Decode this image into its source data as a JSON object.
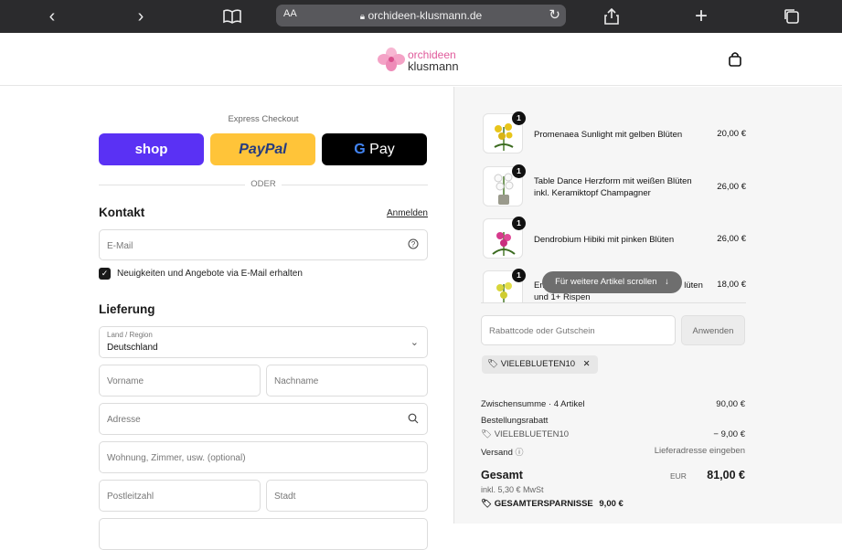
{
  "browser": {
    "text_size_label": "AA",
    "url": "orchideen-klusmann.de"
  },
  "brand": {
    "line1": "orchideen",
    "line2": "klusmann"
  },
  "checkout": {
    "express_label": "Express Checkout",
    "shop_label": "shop",
    "paypal_label": "PayPal",
    "gpay_label": "Pay",
    "gpay_g": "G",
    "divider_label": "ODER",
    "contact_title": "Kontakt",
    "login_label": "Anmelden",
    "email_placeholder": "E-Mail",
    "newsletter_label": "Neuigkeiten und Angebote via E-Mail erhalten",
    "delivery_title": "Lieferung",
    "country_label": "Land / Region",
    "country_value": "Deutschland",
    "firstname_placeholder": "Vorname",
    "lastname_placeholder": "Nachname",
    "address_placeholder": "Adresse",
    "apartment_placeholder": "Wohnung, Zimmer, usw. (optional)",
    "zip_placeholder": "Postleitzahl",
    "city_placeholder": "Stadt"
  },
  "cart": {
    "items": [
      {
        "qty": "1",
        "name": "Promenaea Sunlight mit gelben Blüten",
        "price": "20,00 €"
      },
      {
        "qty": "1",
        "name": "Table Dance Herzform mit weißen Blüten inkl. Keramiktopf Champagner",
        "price": "26,00 €"
      },
      {
        "qty": "1",
        "name": "Dendrobium Hibiki mit pinken Blüten",
        "price": "26,00 €"
      },
      {
        "qty": "1",
        "name_start": "Em",
        "name_end": "lüten",
        "name_line2": "und 1+ Rispen",
        "price": "18,00 €"
      }
    ],
    "scroll_hint": "Für weitere Artikel scrollen",
    "coupon_placeholder": "Rabattcode oder Gutschein",
    "apply_label": "Anwenden",
    "applied_code": "VIELEBLUETEN10",
    "subtotal_label": "Zwischensumme · 4 Artikel",
    "subtotal_value": "90,00 €",
    "discount_label": "Bestellungsrabatt",
    "discount_code": "VIELEBLUETEN10",
    "discount_value": "− 9,00 €",
    "shipping_label": "Versand",
    "shipping_value": "Lieferadresse eingeben",
    "total_label": "Gesamt",
    "total_currency": "EUR",
    "total_value": "81,00 €",
    "tax_label": "inkl. 5,30 € MwSt",
    "savings_label": "GESAMTERSPARNISSE",
    "savings_value": "9,00 €"
  }
}
